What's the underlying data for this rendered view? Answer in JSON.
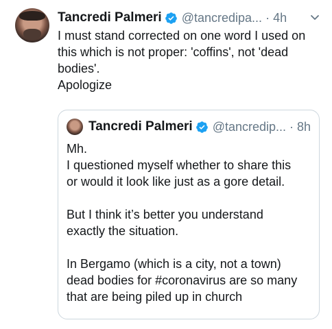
{
  "tweet": {
    "name": "Tancredi Palmeri",
    "handle": "@tancredipa...",
    "separator": "·",
    "time": "4h",
    "text_lines": [
      "I must stand corrected on one word I used on",
      "this which is not proper: 'coffins', not 'dead",
      "bodies'.",
      "Apologize"
    ]
  },
  "quoted_tweet": {
    "name": "Tancredi Palmeri",
    "handle": "@tancredip...",
    "separator": "·",
    "time": "8h",
    "text_lines": [
      "Mh.",
      "I questioned myself whether to share this",
      "or would it look like just as a gore detail.",
      "",
      "But I think it’s better you understand",
      "exactly the situation.",
      "",
      "In Bergamo (which is a city, not a town)",
      "dead bodies for #coronavirus are so many",
      "that are being piled up in church"
    ]
  },
  "colors": {
    "verified": "#1da1f2",
    "secondary_text": "#657786",
    "border": "#ccd6dd"
  }
}
